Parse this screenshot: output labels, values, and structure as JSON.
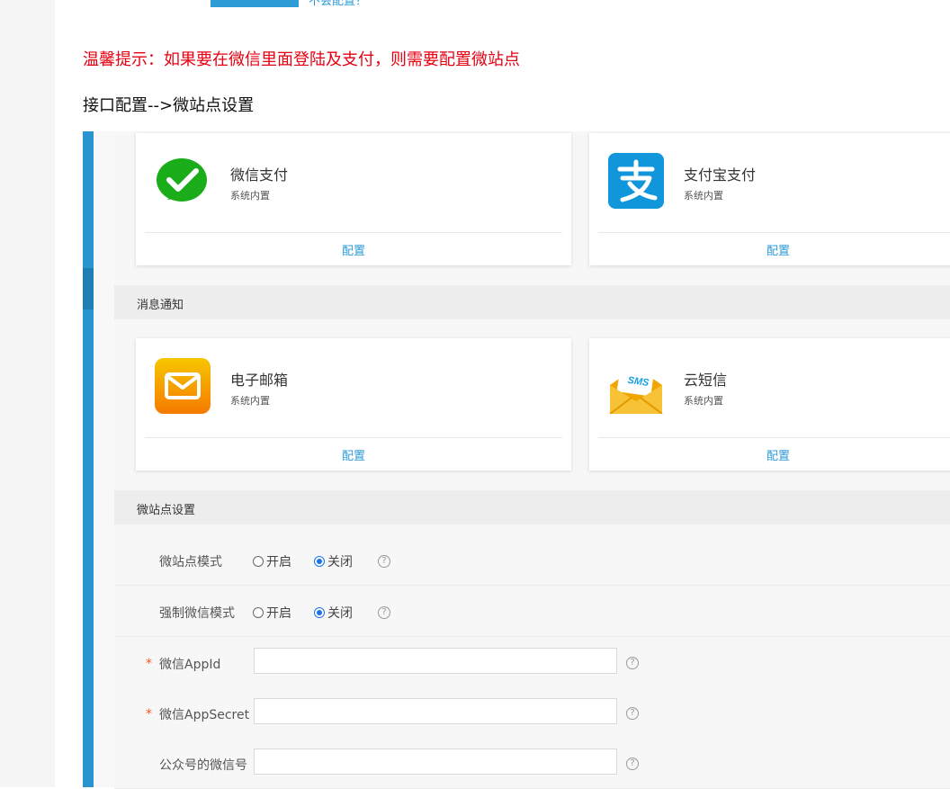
{
  "header": {
    "top_link": "不会配置？",
    "tip": "温馨提示：如果要在微信里面登陆及支付，则需要配置微站点",
    "path": "接口配置-->微站点设置"
  },
  "payment_cards": [
    {
      "name": "微信支付",
      "sub": "系统内置",
      "config": "配置",
      "icon": "wechat-pay-icon",
      "color": "#1aad19"
    },
    {
      "name": "支付宝支付",
      "sub": "系统内置",
      "config": "配置",
      "icon": "alipay-icon",
      "color": "#1296db"
    }
  ],
  "sections": {
    "notify": "消息通知",
    "site": "微站点设置"
  },
  "notify_cards": [
    {
      "name": "电子邮箱",
      "sub": "系统内置",
      "config": "配置",
      "icon": "email-icon"
    },
    {
      "name": "云短信",
      "sub": "系统内置",
      "config": "配置",
      "icon": "sms-icon",
      "badge": "SMS"
    }
  ],
  "form": {
    "site_mode": {
      "label": "微站点模式",
      "on": "开启",
      "off": "关闭",
      "selected": "off"
    },
    "force_wechat": {
      "label": "强制微信模式",
      "on": "开启",
      "off": "关闭",
      "selected": "off"
    },
    "appid": {
      "label": "微信AppId",
      "required": "*",
      "value": ""
    },
    "appsecret": {
      "label": "微信AppSecret",
      "required": "*",
      "value": ""
    },
    "wechat_no": {
      "label": "公众号的微信号",
      "value": ""
    },
    "help": "?"
  }
}
